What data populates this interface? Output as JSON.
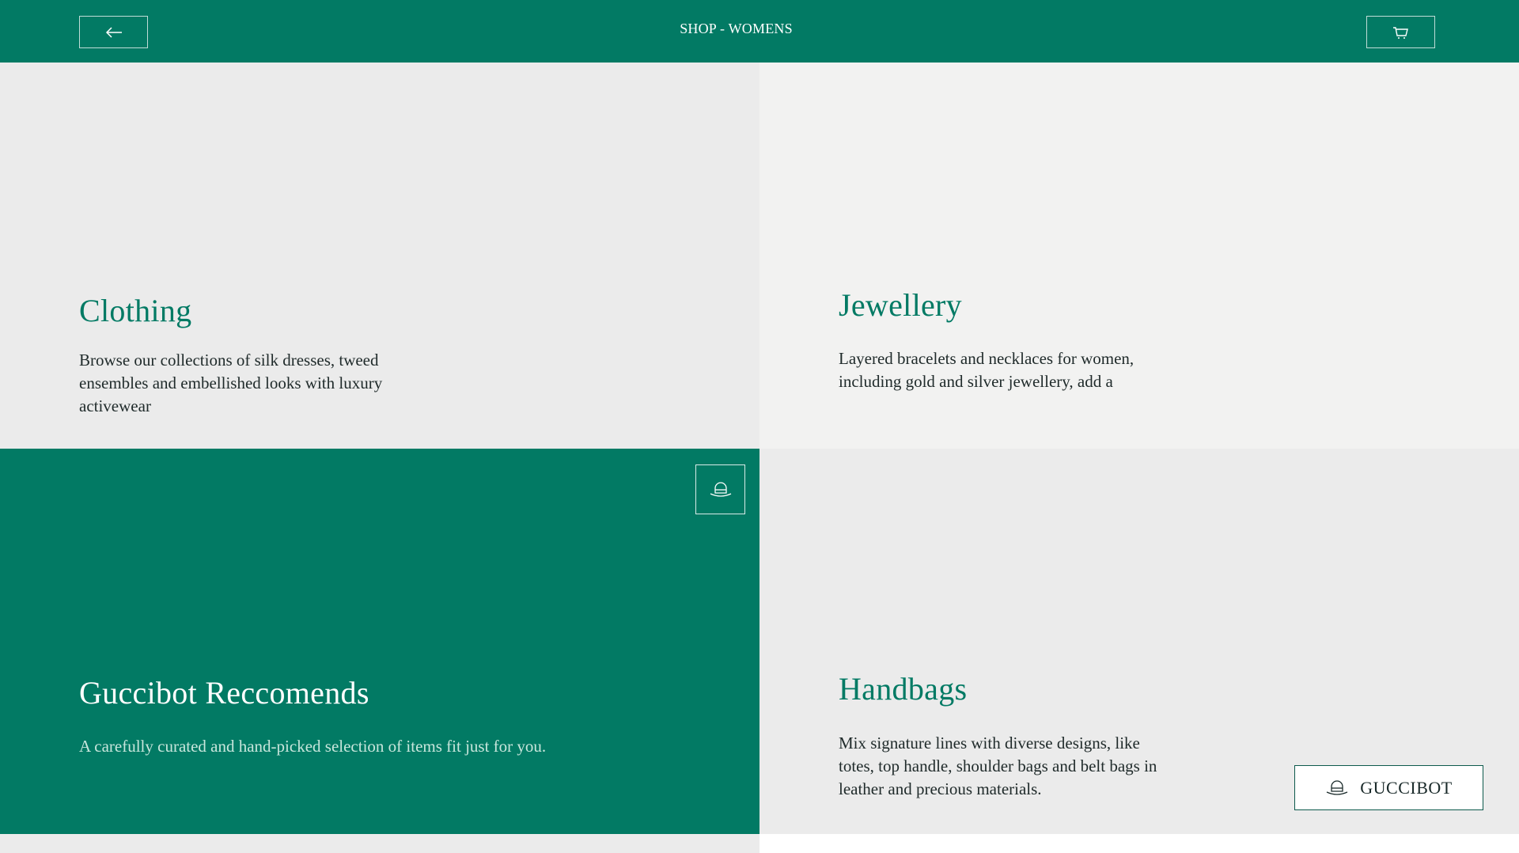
{
  "header": {
    "title": "SHOP - WOMENS",
    "back_icon": "arrow-left-icon",
    "cart_icon": "shopping-cart-icon"
  },
  "tiles": [
    {
      "title": "Clothing",
      "description": "Browse our collections of silk dresses, tweed ensembles and embellished looks with luxury activewear"
    },
    {
      "title": "Jewellery",
      "description": "Layered bracelets and necklaces for women, including gold and silver jewellery, add a"
    },
    {
      "title": "Guccibot Reccomends",
      "description": "A carefully curated and hand-picked selection of items fit just for you.",
      "icon": "guccibot-hat-icon"
    },
    {
      "title": "Handbags",
      "description": "Mix signature lines with diverse designs, like totes, top handle, shoulder bags and belt bags in leather and precious materials."
    }
  ],
  "guccibot_button": {
    "label": "GUCCIBOT",
    "icon": "guccibot-hat-icon"
  },
  "colors": {
    "brand_green": "#027a64",
    "tile_grey": "#ebebeb",
    "tile_light": "#f2f2f1"
  }
}
